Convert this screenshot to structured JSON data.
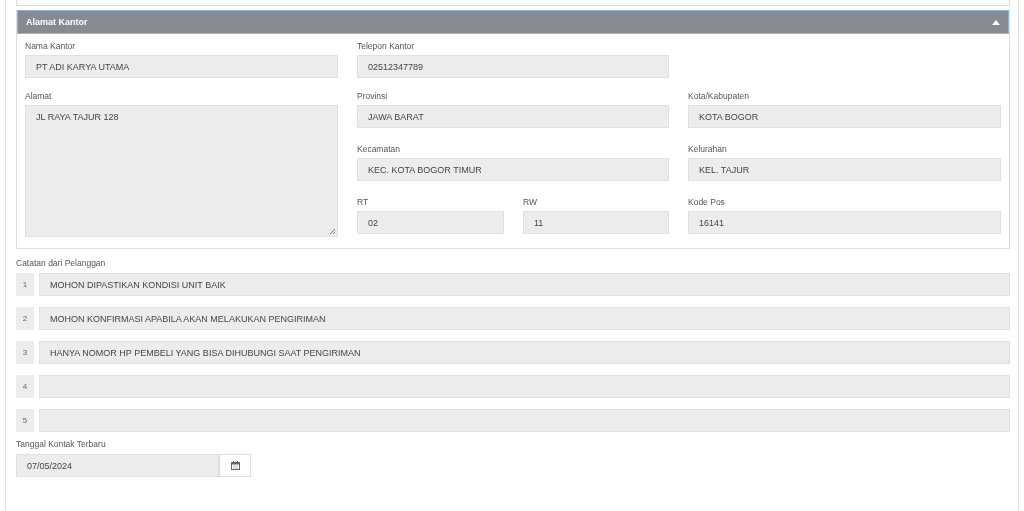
{
  "panel": {
    "title": "Alamat Kantor",
    "expanded": true,
    "fields": [
      {
        "label": "Nama Kantor",
        "value": "PT ADI KARYA UTAMA"
      },
      {
        "label": "Telepon Kantor",
        "value": "02512347789"
      },
      {
        "label": "Alamat",
        "value": "JL RAYA TAJUR 128"
      },
      {
        "label": "Provinsi",
        "value": "JAWA BARAT"
      },
      {
        "label": "Kota/Kabupaten",
        "value": "KOTA BOGOR"
      },
      {
        "label": "Kecamatan",
        "value": "KEC. KOTA BOGOR TIMUR"
      },
      {
        "label": "Kelurahan",
        "value": "KEL. TAJUR"
      },
      {
        "label": "RT",
        "value": "02"
      },
      {
        "label": "RW",
        "value": "11"
      },
      {
        "label": "Kode Pos",
        "value": "16141"
      }
    ]
  },
  "notes": {
    "label": "Catatan dari Pelanggan",
    "items": [
      {
        "number": "1",
        "value": "MOHON DIPASTIKAN KONDISI UNIT BAIK"
      },
      {
        "number": "2",
        "value": "MOHON KONFIRMASI APABILA AKAN MELAKUKAN PENGIRIMAN"
      },
      {
        "number": "3",
        "value": "HANYA NOMOR HP PEMBELI YANG BISA DIHUBUNGI SAAT PENGIRIMAN"
      },
      {
        "number": "4"
      },
      {
        "number": "5"
      }
    ]
  },
  "last_contact": {
    "label": "Tanggal Kontak Terbaru",
    "value": "07/05/2024"
  }
}
